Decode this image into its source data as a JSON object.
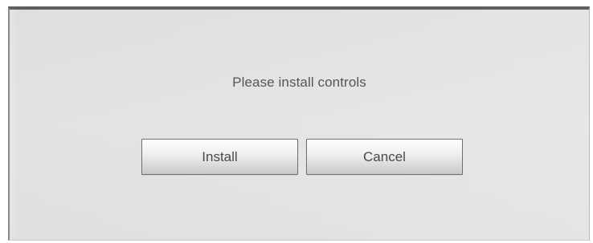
{
  "dialog": {
    "message": "Please install controls",
    "buttons": {
      "install_label": "Install",
      "cancel_label": "Cancel"
    }
  },
  "colors": {
    "dialog_background": "#e4e4e4",
    "top_border": "#5f5f5f",
    "text": "#555555",
    "button_border": "#6e6e6e"
  }
}
